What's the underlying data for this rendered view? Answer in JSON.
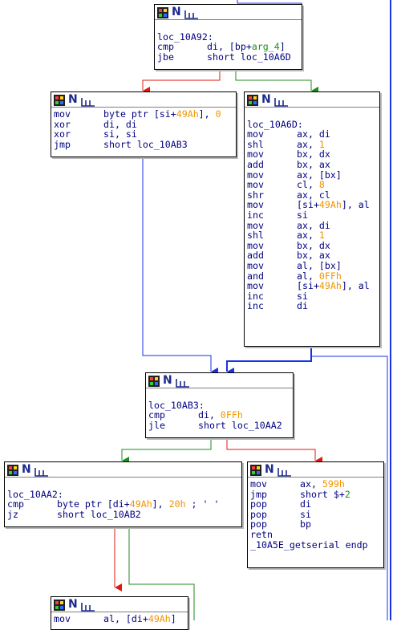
{
  "graph": {
    "header_icon": "graph-node-icon",
    "header_letter": "N",
    "header_rename": "rename-icon",
    "colors": {
      "true_edge": "#1c8c1c",
      "false_edge": "#e0190f",
      "jump_edge": "#1a32e6",
      "text": "#000080",
      "number": "#f09400",
      "variable": "#1a8f1a"
    },
    "nodes": {
      "n10A92": {
        "lines": [
          {
            "t": "blank"
          },
          {
            "t": "label",
            "text": "loc_10A92:"
          },
          {
            "t": "ins",
            "m": "cmp",
            "ops": [
              {
                "s": "di, [bp+"
              },
              {
                "s": "arg_4",
                "c": "var"
              },
              {
                "s": "]"
              }
            ]
          },
          {
            "t": "ins",
            "m": "jbe",
            "ops": [
              {
                "s": "short loc_10A6D"
              }
            ]
          }
        ]
      },
      "nXor": {
        "lines": [
          {
            "t": "ins",
            "m": "mov",
            "ops": [
              {
                "s": "byte ptr [si+"
              },
              {
                "s": "49Ah",
                "c": "num"
              },
              {
                "s": "], "
              },
              {
                "s": "0",
                "c": "num"
              }
            ]
          },
          {
            "t": "ins",
            "m": "xor",
            "ops": [
              {
                "s": "di, di"
              }
            ]
          },
          {
            "t": "ins",
            "m": "xor",
            "ops": [
              {
                "s": "si, si"
              }
            ]
          },
          {
            "t": "ins",
            "m": "jmp",
            "ops": [
              {
                "s": "short loc_10AB3"
              }
            ]
          }
        ]
      },
      "n10A6D": {
        "lines": [
          {
            "t": "blank"
          },
          {
            "t": "label",
            "text": "loc_10A6D:"
          },
          {
            "t": "ins",
            "m": "mov",
            "ops": [
              {
                "s": "ax, di"
              }
            ]
          },
          {
            "t": "ins",
            "m": "shl",
            "ops": [
              {
                "s": "ax, "
              },
              {
                "s": "1",
                "c": "num"
              }
            ]
          },
          {
            "t": "ins",
            "m": "mov",
            "ops": [
              {
                "s": "bx, dx"
              }
            ]
          },
          {
            "t": "ins",
            "m": "add",
            "ops": [
              {
                "s": "bx, ax"
              }
            ]
          },
          {
            "t": "ins",
            "m": "mov",
            "ops": [
              {
                "s": "ax, [bx]"
              }
            ]
          },
          {
            "t": "ins",
            "m": "mov",
            "ops": [
              {
                "s": "cl, "
              },
              {
                "s": "8",
                "c": "num"
              }
            ]
          },
          {
            "t": "ins",
            "m": "shr",
            "ops": [
              {
                "s": "ax, cl"
              }
            ]
          },
          {
            "t": "ins",
            "m": "mov",
            "ops": [
              {
                "s": "[si+"
              },
              {
                "s": "49Ah",
                "c": "num"
              },
              {
                "s": "], al"
              }
            ]
          },
          {
            "t": "ins",
            "m": "inc",
            "ops": [
              {
                "s": "si"
              }
            ]
          },
          {
            "t": "ins",
            "m": "mov",
            "ops": [
              {
                "s": "ax, di"
              }
            ]
          },
          {
            "t": "ins",
            "m": "shl",
            "ops": [
              {
                "s": "ax, "
              },
              {
                "s": "1",
                "c": "num"
              }
            ]
          },
          {
            "t": "ins",
            "m": "mov",
            "ops": [
              {
                "s": "bx, dx"
              }
            ]
          },
          {
            "t": "ins",
            "m": "add",
            "ops": [
              {
                "s": "bx, ax"
              }
            ]
          },
          {
            "t": "ins",
            "m": "mov",
            "ops": [
              {
                "s": "al, [bx]"
              }
            ]
          },
          {
            "t": "ins",
            "m": "and",
            "ops": [
              {
                "s": "al, "
              },
              {
                "s": "0FFh",
                "c": "num"
              }
            ]
          },
          {
            "t": "ins",
            "m": "mov",
            "ops": [
              {
                "s": "[si+"
              },
              {
                "s": "49Ah",
                "c": "num"
              },
              {
                "s": "], al"
              }
            ]
          },
          {
            "t": "ins",
            "m": "inc",
            "ops": [
              {
                "s": "si"
              }
            ]
          },
          {
            "t": "ins",
            "m": "inc",
            "ops": [
              {
                "s": "di"
              }
            ]
          }
        ]
      },
      "n10AB3": {
        "lines": [
          {
            "t": "blank"
          },
          {
            "t": "label",
            "text": "loc_10AB3:"
          },
          {
            "t": "ins",
            "m": "cmp",
            "ops": [
              {
                "s": "di, "
              },
              {
                "s": "0FFh",
                "c": "num"
              }
            ]
          },
          {
            "t": "ins",
            "m": "jle",
            "ops": [
              {
                "s": "short loc_10AA2"
              }
            ]
          }
        ]
      },
      "n10AA2": {
        "lines": [
          {
            "t": "blank"
          },
          {
            "t": "label",
            "text": "loc_10AA2:"
          },
          {
            "t": "ins",
            "m": "cmp",
            "ops": [
              {
                "s": "byte ptr [di+"
              },
              {
                "s": "49Ah",
                "c": "num"
              },
              {
                "s": "], "
              },
              {
                "s": "20h",
                "c": "num"
              },
              {
                "s": " ; ' '"
              }
            ]
          },
          {
            "t": "ins",
            "m": "jz",
            "ops": [
              {
                "s": "short loc_10AB2"
              }
            ]
          }
        ]
      },
      "nRet": {
        "lines": [
          {
            "t": "ins",
            "m": "mov",
            "ops": [
              {
                "s": "ax, "
              },
              {
                "s": "599h",
                "c": "num"
              }
            ]
          },
          {
            "t": "ins",
            "m": "jmp",
            "ops": [
              {
                "s": "short $+"
              },
              {
                "s": "2",
                "c": "var"
              }
            ]
          },
          {
            "t": "ins",
            "m": "pop",
            "ops": [
              {
                "s": "di"
              }
            ]
          },
          {
            "t": "ins",
            "m": "pop",
            "ops": [
              {
                "s": "si"
              }
            ]
          },
          {
            "t": "ins",
            "m": "pop",
            "ops": [
              {
                "s": "bp"
              }
            ]
          },
          {
            "t": "ins",
            "m": "retn",
            "ops": []
          },
          {
            "t": "label",
            "text": "_10A5E_getserial endp"
          }
        ]
      },
      "nBottom": {
        "lines": [
          {
            "t": "ins",
            "m": "mov",
            "ops": [
              {
                "s": "al, [di+"
              },
              {
                "s": "49Ah",
                "c": "num"
              },
              {
                "s": "]"
              }
            ]
          }
        ]
      }
    }
  }
}
